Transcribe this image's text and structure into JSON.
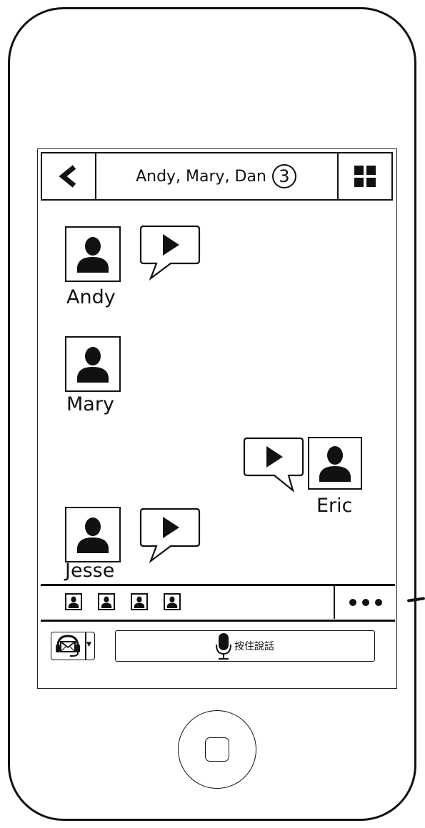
{
  "header": {
    "title": "Andy, Mary, Dan",
    "member_count": "3"
  },
  "messages": [
    {
      "sender": "Andy",
      "type": "voice",
      "side": "left"
    },
    {
      "sender": "Mary",
      "type": "none",
      "side": "left"
    },
    {
      "sender": "Eric",
      "type": "voice",
      "side": "right"
    },
    {
      "sender": "Jesse",
      "type": "voice",
      "side": "left"
    }
  ],
  "member_strip": {
    "members_shown": 4
  },
  "input": {
    "talk_label": "按住說話"
  },
  "icons": {
    "back": "chevron-left-icon",
    "grid": "grid-icon",
    "avatar": "person-icon",
    "voice": "play-icon",
    "more": "more-dots-icon",
    "mode": "headset-mail-icon",
    "mic": "microphone-icon",
    "home": "home-button-icon"
  }
}
